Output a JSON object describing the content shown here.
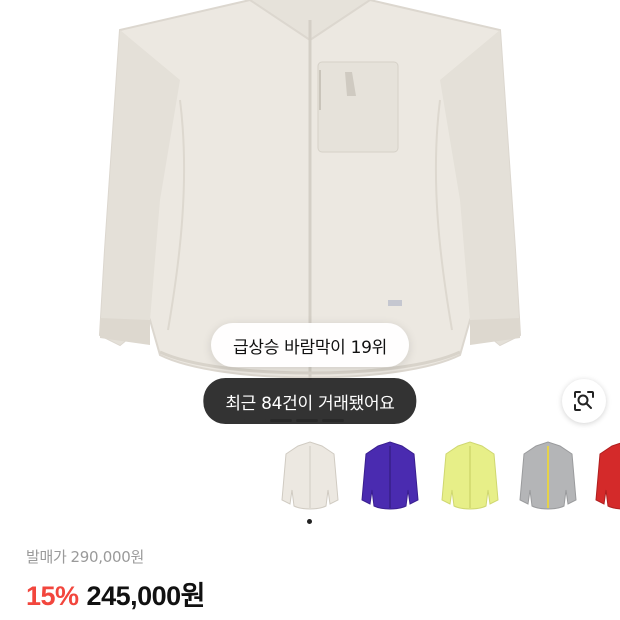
{
  "product": {
    "image_alt": "Windbreaker jacket, light beige",
    "ranking_badge": "급상승 바람막이 19위",
    "trade_badge": "최근 84건이 거래됐어요",
    "gallery_pages": 4,
    "gallery_current": 1
  },
  "colors": {
    "accent_discount": "#f2463d",
    "muted": "#9a9a9a",
    "jacket_main": "#ece8e1"
  },
  "variants": [
    {
      "name": "beige",
      "color": "#ece8e1",
      "selected": true
    },
    {
      "name": "purple",
      "color": "#4a2bb0",
      "selected": false
    },
    {
      "name": "lime",
      "color": "#e7ef88",
      "selected": false
    },
    {
      "name": "grey",
      "color": "#b4b5b7",
      "selected": false
    },
    {
      "name": "red",
      "color": "#d42a2a",
      "selected": false
    }
  ],
  "pricing": {
    "original_label": "발매가",
    "original_price": "290,000원",
    "discount": "15%",
    "sale_price": "245,000원"
  },
  "icons": {
    "lens": "image-search-icon"
  }
}
